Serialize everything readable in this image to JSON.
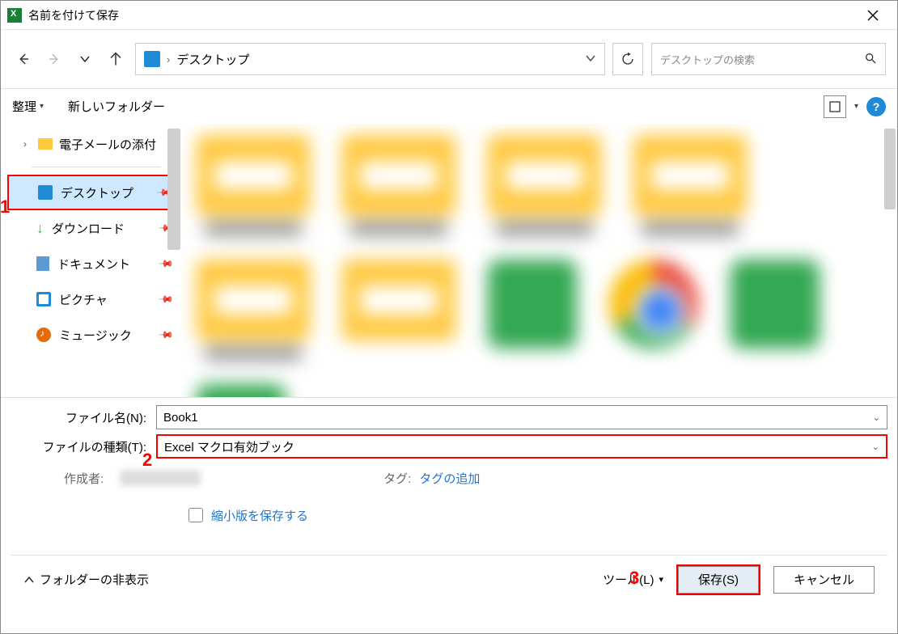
{
  "window": {
    "title": "名前を付けて保存"
  },
  "nav": {
    "location": "デスクトップ",
    "search_placeholder": "デスクトップの検索"
  },
  "toolbar": {
    "organize": "整理",
    "new_folder": "新しいフォルダー"
  },
  "tree": {
    "attachments": "電子メールの添付"
  },
  "quick": {
    "desktop": "デスクトップ",
    "downloads": "ダウンロード",
    "documents": "ドキュメント",
    "pictures": "ピクチャ",
    "music": "ミュージック"
  },
  "form": {
    "filename_label": "ファイル名(N):",
    "filename_value": "Book1",
    "filetype_label": "ファイルの種類(T):",
    "filetype_value": "Excel マクロ有効ブック",
    "author_label": "作成者:",
    "tag_label": "タグ:",
    "tag_value": "タグの追加",
    "thumb_label": "縮小版を保存する"
  },
  "footer": {
    "hide_folders": "フォルダーの非表示",
    "tools": "ツール(L)",
    "save": "保存(S)",
    "cancel": "キャンセル"
  },
  "annot": {
    "a1": "1",
    "a2": "2",
    "a3": "3"
  }
}
